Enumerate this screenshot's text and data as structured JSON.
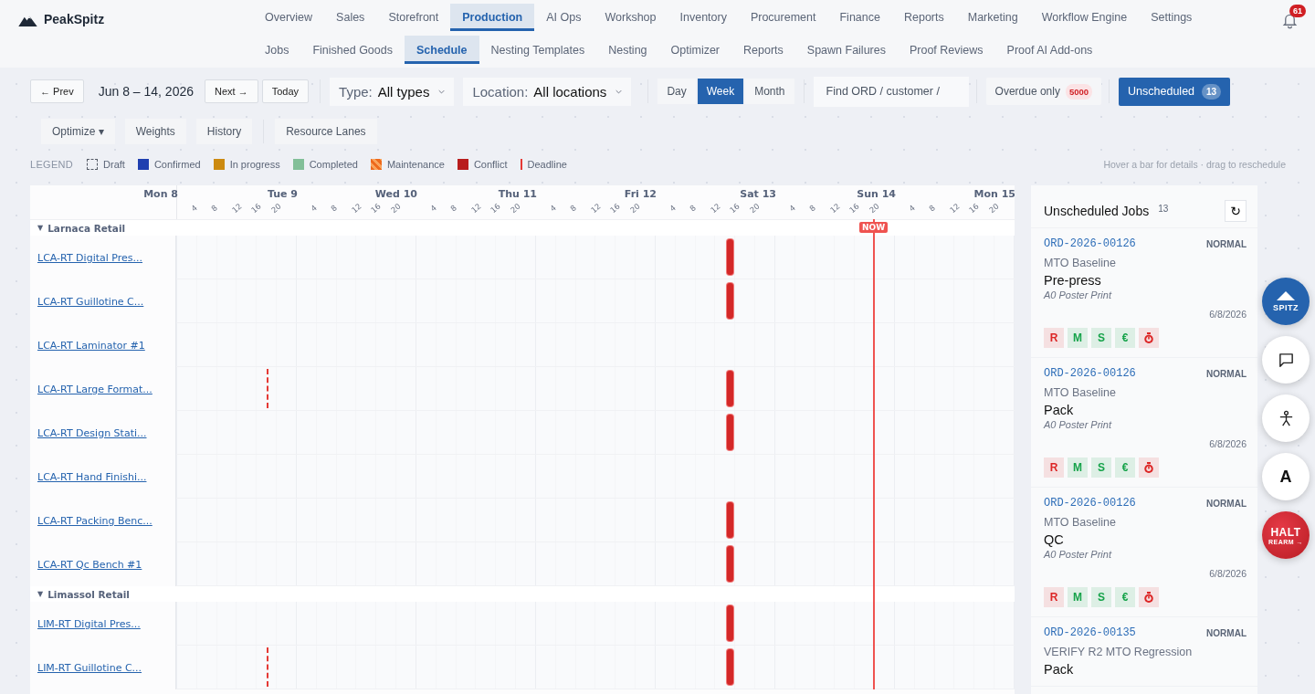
{
  "brand": {
    "name": "PeakSpitz"
  },
  "nav": [
    {
      "label": "Overview",
      "selected": false
    },
    {
      "label": "Sales",
      "selected": false
    },
    {
      "label": "Storefront",
      "selected": false
    },
    {
      "label": "Production",
      "selected": true
    },
    {
      "label": "AI Ops",
      "selected": false
    },
    {
      "label": "Workshop",
      "selected": false
    },
    {
      "label": "Inventory",
      "selected": false
    },
    {
      "label": "Procurement",
      "selected": false
    },
    {
      "label": "Finance",
      "selected": false
    },
    {
      "label": "Reports",
      "selected": false
    },
    {
      "label": "Marketing",
      "selected": false
    },
    {
      "label": "Workflow Engine",
      "selected": false
    },
    {
      "label": "Settings",
      "selected": false
    }
  ],
  "notifications": {
    "count": "61"
  },
  "subnav": [
    {
      "label": "Jobs",
      "selected": false
    },
    {
      "label": "Finished Goods",
      "selected": false
    },
    {
      "label": "Schedule",
      "selected": true
    },
    {
      "label": "Nesting Templates",
      "selected": false
    },
    {
      "label": "Nesting",
      "selected": false
    },
    {
      "label": "Optimizer",
      "selected": false
    },
    {
      "label": "Reports",
      "selected": false
    },
    {
      "label": "Spawn Failures",
      "selected": false
    },
    {
      "label": "Proof Reviews",
      "selected": false
    },
    {
      "label": "Proof AI Add-ons",
      "selected": false
    }
  ],
  "toolbar": {
    "prev": "← Prev",
    "range": "Jun 8 – 14, 2026",
    "next": "Next →",
    "today": "Today",
    "type_filter": {
      "label": "Type:",
      "value": "All types"
    },
    "location_filter": {
      "label": "Location:",
      "value": "All locations"
    },
    "views": [
      {
        "label": "Day",
        "selected": false
      },
      {
        "label": "Week",
        "selected": true
      },
      {
        "label": "Month",
        "selected": false
      }
    ],
    "search": {
      "placeholder": "Find ORD / customer /"
    },
    "overdue": {
      "label": "Overdue only",
      "count": "5000",
      "on": false
    },
    "unscheduled": {
      "label": "Unscheduled",
      "count": "13",
      "selected": true
    }
  },
  "actions": [
    "Optimize ▾",
    "Weights",
    "History",
    "Resource Lanes"
  ],
  "legend": {
    "title": "LEGEND",
    "hint": "Hover a bar for details · drag to reschedule",
    "items": [
      {
        "label": "Draft",
        "kind": "dashed",
        "color": "#555b66"
      },
      {
        "label": "Confirmed",
        "kind": "solid",
        "color": "#1f3fb0"
      },
      {
        "label": "In progress",
        "kind": "solid",
        "color": "#cc8a10"
      },
      {
        "label": "Completed",
        "kind": "solid",
        "color": "#82bf98"
      },
      {
        "label": "Maintenance",
        "kind": "striped",
        "color": "#ee6a1c"
      },
      {
        "label": "Conflict",
        "kind": "solid",
        "color": "#b81d1d"
      },
      {
        "label": "Deadline",
        "kind": "line",
        "color": "#e53935"
      }
    ]
  },
  "gantt": {
    "now_label": "NOW",
    "days": [
      {
        "label": "Mon 8",
        "hours": [
          "4",
          "8",
          "12",
          "16",
          "20"
        ]
      },
      {
        "label": "Tue 9",
        "hours": [
          "4",
          "8",
          "12",
          "16",
          "20"
        ]
      },
      {
        "label": "Wed 10",
        "hours": [
          "4",
          "8",
          "12",
          "16",
          "20"
        ]
      },
      {
        "label": "Thu 11",
        "hours": [
          "4",
          "8",
          "12",
          "16",
          "20"
        ]
      },
      {
        "label": "Fri 12",
        "hours": [
          "4",
          "8",
          "12",
          "16",
          "20"
        ]
      },
      {
        "label": "Sat 13",
        "hours": [
          "4",
          "8",
          "12",
          "16",
          "20"
        ]
      },
      {
        "label": "Sun 14",
        "hours": [
          "4",
          "8",
          "12",
          "16",
          "20"
        ]
      },
      {
        "label": "Mon 15"
      }
    ],
    "groups": [
      {
        "toggle": "▼",
        "name": "Larnaca Retail",
        "rows": [
          {
            "name": "LCA-RT Digital Pres...",
            "conflict": true,
            "deadline": false
          },
          {
            "name": "LCA-RT Guillotine C...",
            "conflict": true,
            "deadline": false
          },
          {
            "name": "LCA-RT Laminator #1",
            "conflict": false,
            "deadline": false
          },
          {
            "name": "LCA-RT Large Format...",
            "conflict": true,
            "deadline": true
          },
          {
            "name": "LCA-RT Design Stati...",
            "conflict": true,
            "deadline": false
          },
          {
            "name": "LCA-RT Hand Finishi...",
            "conflict": false,
            "deadline": false
          },
          {
            "name": "LCA-RT Packing Benc...",
            "conflict": true,
            "deadline": false
          },
          {
            "name": "LCA-RT Qc Bench #1",
            "conflict": true,
            "deadline": false
          }
        ]
      },
      {
        "toggle": "▼",
        "name": "Limassol Retail",
        "rows": [
          {
            "name": "LIM-RT Digital Pres...",
            "conflict": true,
            "deadline": false
          },
          {
            "name": "LIM-RT Guillotine C...",
            "conflict": true,
            "deadline": true
          }
        ]
      }
    ]
  },
  "unscheduled_panel": {
    "title": "Unscheduled Jobs",
    "count": "13",
    "refresh": "↻",
    "cards": [
      {
        "order": "ORD-2026-00126",
        "priority": "NORMAL",
        "customer": "MTO Baseline",
        "step": "Pre-press",
        "product": "A0 Poster Print",
        "date": "6/8/2026",
        "checks": [
          {
            "kind": "text",
            "label": "R",
            "color": "#dc2626"
          },
          {
            "kind": "text",
            "label": "M",
            "color": "#16a34a"
          },
          {
            "kind": "text",
            "label": "S",
            "color": "#16a34a"
          },
          {
            "kind": "text",
            "label": "€",
            "color": "#16a34a"
          },
          {
            "kind": "timer",
            "color": "#dc2626"
          }
        ]
      },
      {
        "order": "ORD-2026-00126",
        "priority": "NORMAL",
        "customer": "MTO Baseline",
        "step": "Pack",
        "product": "A0 Poster Print",
        "date": "6/8/2026",
        "checks": [
          {
            "kind": "text",
            "label": "R",
            "color": "#dc2626"
          },
          {
            "kind": "text",
            "label": "M",
            "color": "#16a34a"
          },
          {
            "kind": "text",
            "label": "S",
            "color": "#16a34a"
          },
          {
            "kind": "text",
            "label": "€",
            "color": "#16a34a"
          },
          {
            "kind": "timer",
            "color": "#dc2626"
          }
        ]
      },
      {
        "order": "ORD-2026-00126",
        "priority": "NORMAL",
        "customer": "MTO Baseline",
        "step": "QC",
        "product": "A0 Poster Print",
        "date": "6/8/2026",
        "checks": [
          {
            "kind": "text",
            "label": "R",
            "color": "#dc2626"
          },
          {
            "kind": "text",
            "label": "M",
            "color": "#16a34a"
          },
          {
            "kind": "text",
            "label": "S",
            "color": "#16a34a"
          },
          {
            "kind": "text",
            "label": "€",
            "color": "#16a34a"
          },
          {
            "kind": "timer",
            "color": "#dc2626"
          }
        ]
      },
      {
        "order": "ORD-2026-00135",
        "priority": "NORMAL",
        "customer": "VERIFY R2 MTO Regression",
        "step": "Pack"
      }
    ]
  },
  "floating": {
    "assistant": "SPITZ",
    "font_button": "A",
    "halt": {
      "label": "HALT",
      "sub": "REARM →"
    }
  }
}
